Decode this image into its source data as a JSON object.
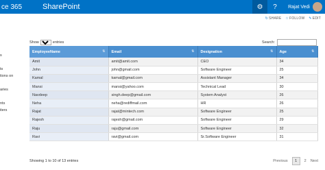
{
  "suitebar": {
    "brand": "ce 365",
    "site": "SharePoint",
    "settings_icon": "gear-icon",
    "help_icon": "question-icon",
    "user_name": "Rajat Vedi"
  },
  "page_actions": {
    "share": "SHARE",
    "follow": "FOLLOW",
    "edit": "EDIT"
  },
  "leftnav": [
    "s",
    "",
    "ts",
    "tions on",
    "",
    "aries",
    "",
    "nts",
    "iters"
  ],
  "table_controls": {
    "show_label": "Show",
    "entries_value": "10",
    "entries_label": "entries",
    "search_label": "Search:",
    "search_value": ""
  },
  "table": {
    "columns": [
      "EmployeeName",
      "Email",
      "Designation",
      "Age"
    ],
    "rows": [
      [
        "Amit",
        "amit@amit.com",
        "CEO",
        "34"
      ],
      [
        "John",
        "john@gmail.com",
        "Software Engineer",
        "25"
      ],
      [
        "Kamal",
        "kamal@gmail.com",
        "Assistant Manager",
        "34"
      ],
      [
        "Mansi",
        "mansi@yahoo.com",
        "Technical Lead",
        "30"
      ],
      [
        "Navdeep",
        "singh.deep@gmail.com",
        "System Analyst",
        "26"
      ],
      [
        "Neha",
        "neha@rediffmail.com",
        "HR",
        "26"
      ],
      [
        "Rajat",
        "rajat@mintech.com",
        "Software Engineer",
        "25"
      ],
      [
        "Rajesh",
        "rajesh@gmail.com",
        "Software Engineer",
        "29"
      ],
      [
        "Raju",
        "raju@gmail.com",
        "Software Engineer",
        "32"
      ],
      [
        "Ravi",
        "ravi@gmail.com",
        "Sr.Software Engineer",
        "31"
      ]
    ]
  },
  "footer": {
    "info": "Showing 1 to 10 of 13 entries",
    "previous": "Previous",
    "pages": [
      "1",
      "2"
    ],
    "next": "Next"
  }
}
